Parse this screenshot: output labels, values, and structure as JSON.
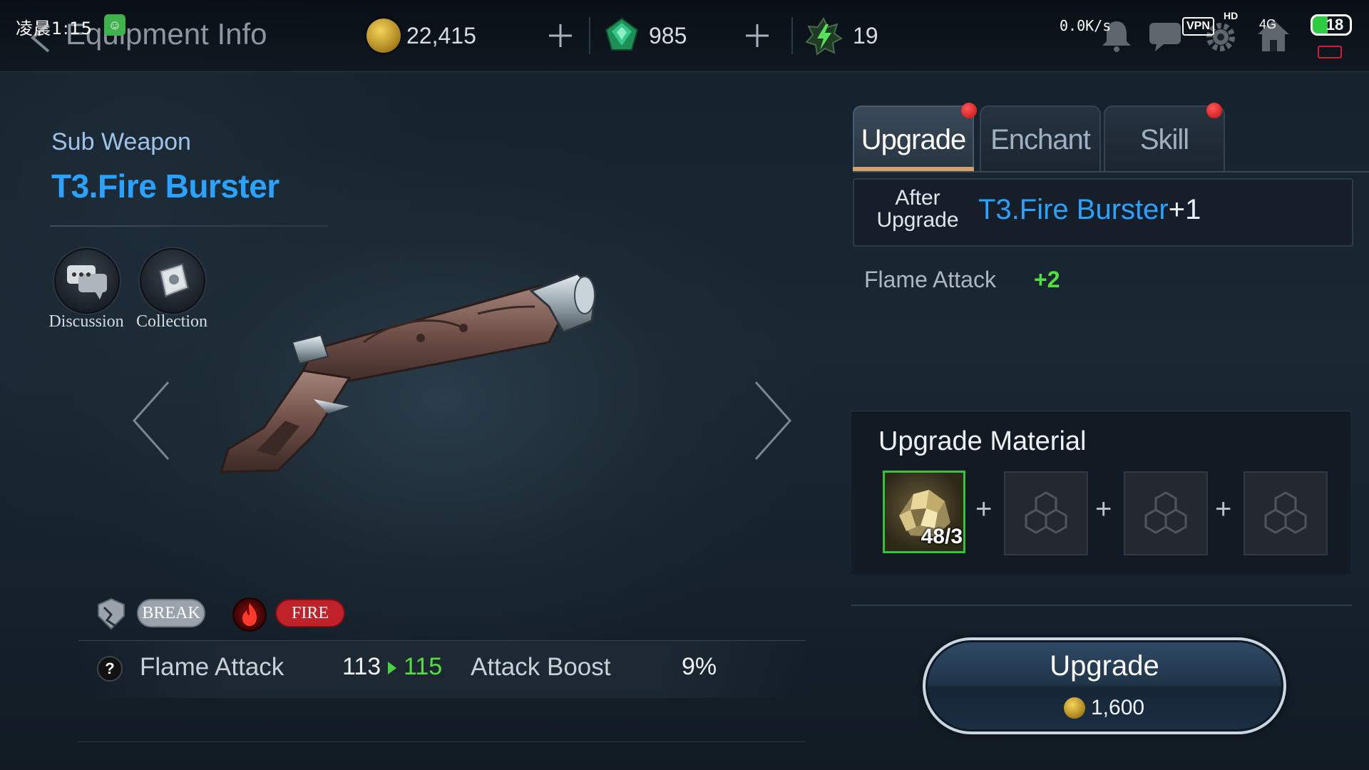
{
  "status": {
    "time": "凌晨1:15",
    "net_speed": "0.0K/s",
    "vpn": "VPN",
    "hd": "HD",
    "network": "4G",
    "battery": "18"
  },
  "header": {
    "title": "Equipment Info"
  },
  "resources": {
    "gold": "22,415",
    "gems": "985",
    "energy": "19"
  },
  "item": {
    "subtype": "Sub Weapon",
    "name": "T3.Fire Burster",
    "actions": [
      {
        "label": "Discussion",
        "icon": "chat-bubbles-icon"
      },
      {
        "label": "Collection",
        "icon": "book-icon"
      }
    ],
    "tags": {
      "break": "BREAK",
      "fire": "FIRE"
    },
    "stat": {
      "name": "Flame Attack",
      "old": "113",
      "new": "115",
      "boost_name": "Attack Boost",
      "boost_value": "9%"
    }
  },
  "tabs": [
    {
      "label": "Upgrade",
      "active": true,
      "notify": true
    },
    {
      "label": "Enchant",
      "active": false,
      "notify": false
    },
    {
      "label": "Skill",
      "active": false,
      "notify": true
    }
  ],
  "upgrade": {
    "after_label": "After Upgrade",
    "after_name": "T3.Fire Burster",
    "after_level": "+1",
    "bonus_name": "Flame Attack",
    "bonus_value": "+2",
    "material_title": "Upgrade Material",
    "materials": [
      {
        "icon": "ore-icon",
        "count": "48/3"
      },
      {
        "icon": "empty-slot-icon"
      },
      {
        "icon": "empty-slot-icon"
      },
      {
        "icon": "empty-slot-icon"
      }
    ],
    "button_label": "Upgrade",
    "cost": "1,600"
  },
  "colors": {
    "accent_blue": "#29a3ff",
    "stat_green": "#52e13c",
    "fire_red": "#c0222a",
    "notify_red": "#e01818"
  }
}
